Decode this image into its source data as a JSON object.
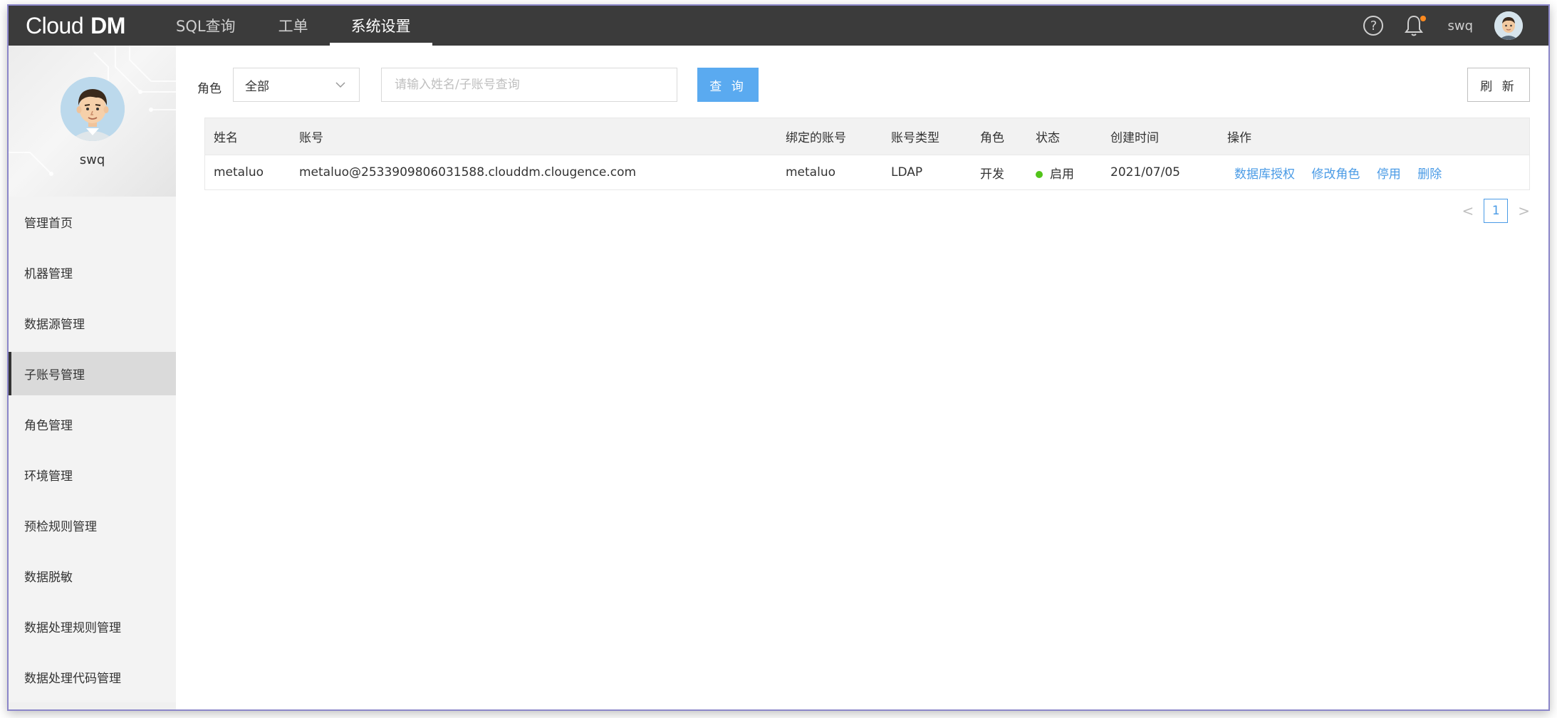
{
  "header": {
    "logo_text": "Cloud",
    "logo_bold": "DM",
    "nav": [
      {
        "label": "SQL查询",
        "active": false
      },
      {
        "label": "工单",
        "active": false
      },
      {
        "label": "系统设置",
        "active": true
      }
    ],
    "help_symbol": "?",
    "username": "swq",
    "icons": [
      "help-icon",
      "bell-icon",
      "avatar"
    ],
    "notification_dot_color": "#ff8a1f"
  },
  "sidebar": {
    "profile_name": "swq",
    "items": [
      {
        "label": "管理首页",
        "active": false
      },
      {
        "label": "机器管理",
        "active": false
      },
      {
        "label": "数据源管理",
        "active": false
      },
      {
        "label": "子账号管理",
        "active": true
      },
      {
        "label": "角色管理",
        "active": false
      },
      {
        "label": "环境管理",
        "active": false
      },
      {
        "label": "预检规则管理",
        "active": false
      },
      {
        "label": "数据脱敏",
        "active": false
      },
      {
        "label": "数据处理规则管理",
        "active": false
      },
      {
        "label": "数据处理代码管理",
        "active": false
      }
    ]
  },
  "filters": {
    "role_label": "角色",
    "role_value": "全部",
    "search_placeholder": "请输入姓名/子账号查询",
    "search_value": "",
    "query_button": "查 询",
    "refresh_button": "刷 新"
  },
  "table": {
    "headers": [
      "姓名",
      "账号",
      "绑定的账号",
      "账号类型",
      "角色",
      "状态",
      "创建时间",
      "操作"
    ],
    "rows": [
      {
        "name": "metaluo",
        "account": "metaluo@2533909806031588.clouddm.clougence.com",
        "bound_account": "metaluo",
        "account_type": "LDAP",
        "role": "开发",
        "status": "启用",
        "created": "2021/07/05",
        "actions": [
          "数据库授权",
          "修改角色",
          "停用",
          "删除"
        ]
      }
    ]
  },
  "pagination": {
    "current_page": "1",
    "prev_symbol": "<",
    "next_symbol": ">"
  },
  "colors": {
    "topbar": "#3b3b3b",
    "accent": "#5aaaf0",
    "link": "#4a9be6",
    "status_enabled": "#52c41a"
  }
}
